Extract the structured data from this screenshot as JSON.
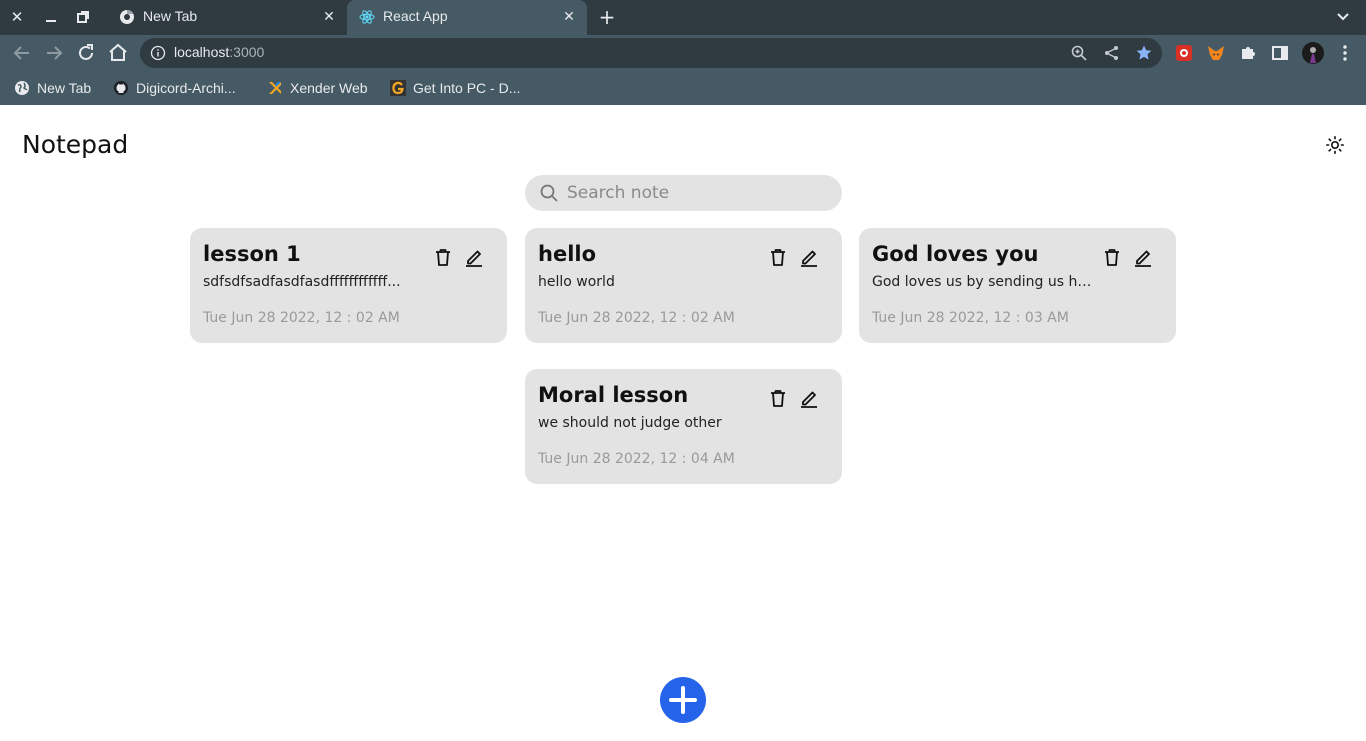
{
  "browser": {
    "tabs": [
      {
        "label": "New Tab",
        "icon": "chrome-icon",
        "active": false
      },
      {
        "label": "React App",
        "icon": "react-icon",
        "active": true
      }
    ],
    "address": {
      "host": "localhost",
      "port": ":3000"
    },
    "bookmarks": [
      {
        "label": "New Tab",
        "icon": "globe-icon"
      },
      {
        "label": "Digicord-Archi...",
        "icon": "github-icon"
      },
      {
        "label": "Xender Web",
        "icon": "xender-icon"
      },
      {
        "label": "Get Into PC - D...",
        "icon": "getintopc-icon"
      }
    ]
  },
  "app": {
    "title": "Notepad",
    "search": {
      "placeholder": "Search note",
      "value": ""
    },
    "notes": [
      {
        "title": "lesson 1",
        "body": "sdfsdfsadfasdfasdffffffffffff...",
        "date": "Tue Jun 28 2022, 12 : 02 AM"
      },
      {
        "title": "hello",
        "body": "hello world",
        "date": "Tue Jun 28 2022, 12 : 02 AM"
      },
      {
        "title": "God loves you",
        "body": "God loves us by sending us hi...",
        "date": "Tue Jun 28 2022, 12 : 03 AM"
      },
      {
        "title": "Moral lesson",
        "body": "we should not judge other",
        "date": "Tue Jun 28 2022, 12 : 04 AM"
      }
    ]
  },
  "colors": {
    "card_bg": "#e3e3e3",
    "accent": "#2563eb",
    "chrome_dark": "#2f3b41",
    "chrome_light": "#455a64"
  }
}
